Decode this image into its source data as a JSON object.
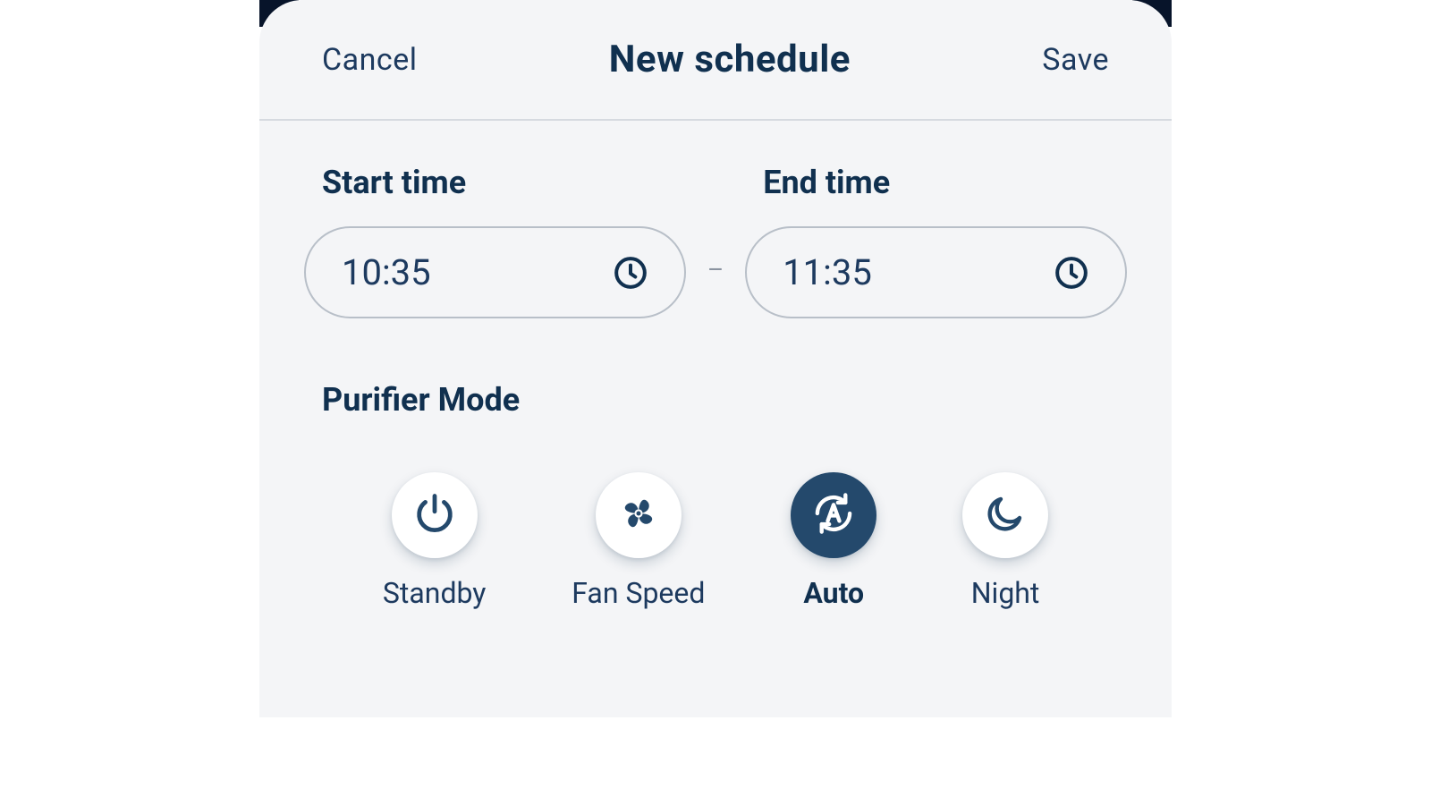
{
  "header": {
    "cancel": "Cancel",
    "title": "New schedule",
    "save": "Save"
  },
  "times": {
    "start_label": "Start time",
    "end_label": "End time",
    "start_value": "10:35",
    "end_value": "11:35",
    "separator": "–"
  },
  "purifier": {
    "label": "Purifier Mode",
    "modes": {
      "standby": "Standby",
      "fan_speed": "Fan Speed",
      "auto": "Auto",
      "night": "Night"
    },
    "selected": "auto"
  },
  "colors": {
    "primary": "#10304f",
    "accent": "#24496c"
  }
}
